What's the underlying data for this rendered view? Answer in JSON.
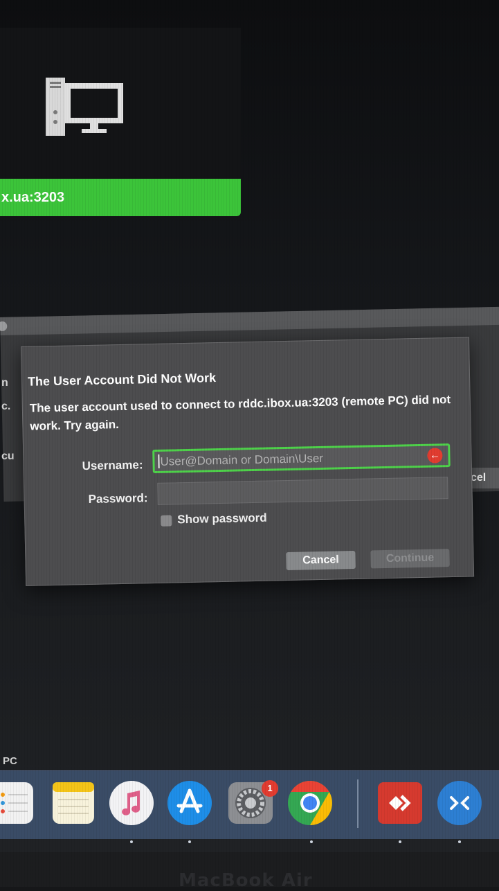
{
  "remote_pc": {
    "host_label": "x.ua:3203"
  },
  "background_window": {
    "fragments": [
      "n",
      "c.",
      "cu",
      "cel"
    ]
  },
  "dialog": {
    "title": "The User Account Did Not Work",
    "message": "The user account used to connect to rddc.ibox.ua:3203 (remote PC) did not work. Try again.",
    "username_label": "Username:",
    "username_placeholder": "User@Domain or Domain\\User",
    "username_value": "",
    "password_label": "Password:",
    "show_password_label": "Show password",
    "show_password_checked": false,
    "cancel_label": "Cancel",
    "continue_label": "Continue",
    "error_color": "#e23c30",
    "focus_color": "#4ed24a"
  },
  "bottom_label": "PC",
  "dock": {
    "items": [
      {
        "name": "reminders",
        "icon": "reminders-icon"
      },
      {
        "name": "notes",
        "icon": "notes-icon"
      },
      {
        "name": "music",
        "icon": "music-icon"
      },
      {
        "name": "app-store",
        "icon": "app-store-icon"
      },
      {
        "name": "system-preferences",
        "icon": "gear-icon",
        "badge": "1"
      },
      {
        "name": "chrome",
        "icon": "chrome-icon"
      },
      {
        "name": "anydesk",
        "icon": "anydesk-icon"
      },
      {
        "name": "remote-desktop",
        "icon": "remote-desktop-icon"
      }
    ]
  },
  "bezel": {
    "brand": "MacBook Air"
  }
}
